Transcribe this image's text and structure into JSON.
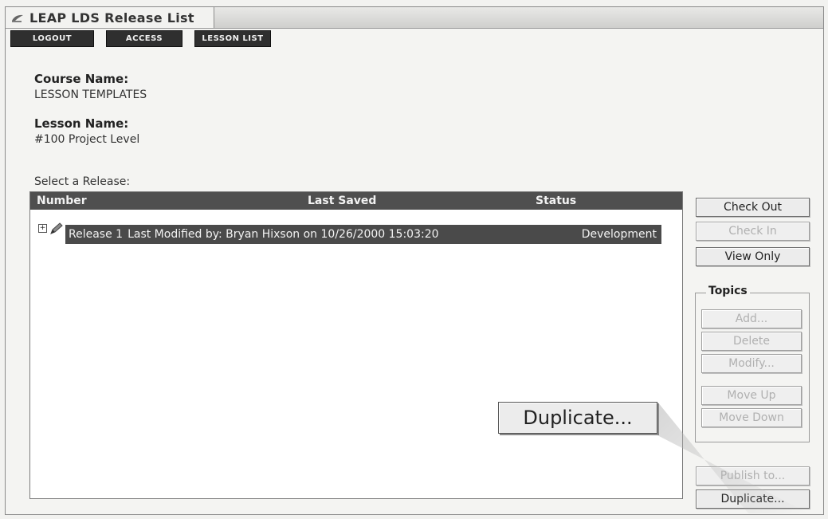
{
  "window": {
    "title": "LEAP LDS Release List"
  },
  "nav": {
    "logout": "LOGOUT",
    "access": "ACCESS",
    "lesson_list": "LESSON LIST"
  },
  "course": {
    "label": "Course Name:",
    "value": "LESSON TEMPLATES"
  },
  "lesson": {
    "label": "Lesson Name:",
    "value": "#100 Project Level"
  },
  "release_list": {
    "prompt": "Select a Release:",
    "columns": [
      "Number",
      "Last Saved",
      "Status"
    ],
    "rows": [
      {
        "number": "Release 1",
        "last_saved": "Last Modified by: Bryan Hixson on 10/26/2000 15:03:20",
        "status": "Development",
        "selected": true
      }
    ]
  },
  "actions": {
    "check_out": "Check Out",
    "check_in": "Check In",
    "view_only": "View Only",
    "duplicate": "Duplicate..."
  },
  "topics": {
    "label": "Topics",
    "add": "Add...",
    "delete": "Delete",
    "modify": "Modify...",
    "move_up": "Move Up",
    "move_down": "Move Down"
  },
  "publish": {
    "label": "Publish to..."
  },
  "callout": {
    "label": "Duplicate..."
  },
  "icons": {
    "title": "leap-logo-icon",
    "expander": "plus-expand-icon",
    "release": "pencil-icon"
  }
}
